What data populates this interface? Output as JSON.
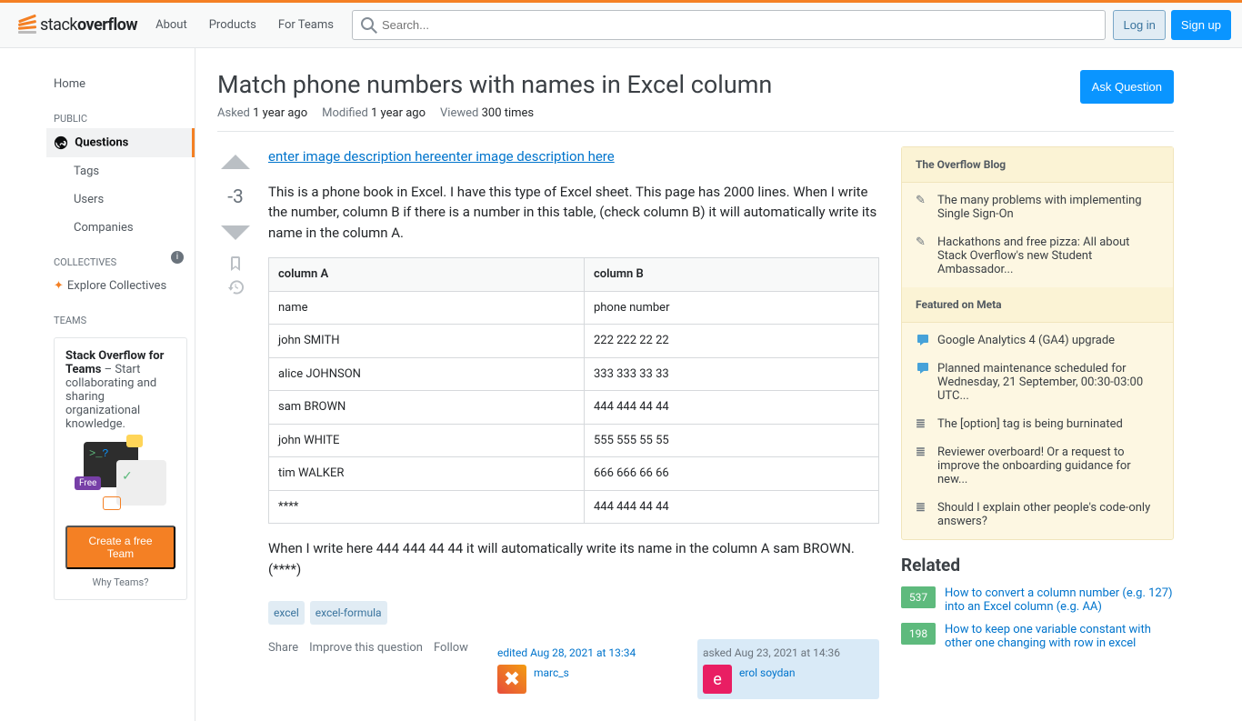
{
  "header": {
    "logo_text_1": "stack",
    "logo_text_2": "overflow",
    "nav": {
      "about": "About",
      "products": "Products",
      "for_teams": "For Teams"
    },
    "search_placeholder": "Search...",
    "login": "Log in",
    "signup": "Sign up"
  },
  "sidebar": {
    "home": "Home",
    "public_heading": "PUBLIC",
    "questions": "Questions",
    "tags": "Tags",
    "users": "Users",
    "companies": "Companies",
    "collectives_heading": "COLLECTIVES",
    "explore_collectives": "Explore Collectives",
    "teams_heading": "TEAMS",
    "teams_box_title": "Stack Overflow for Teams",
    "teams_box_text": " – Start collaborating and sharing organizational knowledge.",
    "teams_free_badge": "Free",
    "create_team": "Create a free Team",
    "why_teams": "Why Teams?"
  },
  "question": {
    "title": "Match phone numbers with names in Excel column",
    "ask_button": "Ask Question",
    "asked_label": "Asked",
    "asked_val": "1 year ago",
    "modified_label": "Modified",
    "modified_val": "1 year ago",
    "viewed_label": "Viewed",
    "viewed_val": "300 times",
    "vote_count": "-3",
    "body": {
      "link_text": "enter image description hereenter image description here",
      "para1": "This is a phone book in Excel. I have this type of Excel sheet. This page has 2000 lines. When I write the number, column B if there is a number in this table, (check column B) it will automatically write its name in the column A.",
      "table_headers": [
        "column A",
        "column B"
      ],
      "table_rows": [
        [
          "name",
          "phone number"
        ],
        [
          "john SMITH",
          "222 222 22 22"
        ],
        [
          "alice JOHNSON",
          "333 333 33 33"
        ],
        [
          "sam BROWN",
          "444 444 44 44"
        ],
        [
          "john WHITE",
          "555 555 55 55"
        ],
        [
          "tim WALKER",
          "666 666 66 66"
        ],
        [
          "****",
          "444 444 44 44"
        ]
      ],
      "para2": "When I write here 444 444 44 44 it will automatically write its name in the column A sam BROWN.(****)"
    },
    "tags": [
      "excel",
      "excel-formula"
    ],
    "actions": {
      "share": "Share",
      "improve": "Improve this question",
      "follow": "Follow"
    },
    "edited": {
      "action": "edited Aug 28, 2021 at 13:34",
      "user": "marc_s"
    },
    "asked": {
      "action": "asked Aug 23, 2021 at 14:36",
      "user": "erol soydan",
      "avatar_letter": "e"
    }
  },
  "right": {
    "blog_heading": "The Overflow Blog",
    "blog_items": [
      "The many problems with implementing Single Sign-On",
      "Hackathons and free pizza: All about Stack Overflow's new Student Ambassador..."
    ],
    "meta_heading": "Featured on Meta",
    "meta_items": [
      {
        "icon": "speech",
        "text": "Google Analytics 4 (GA4) upgrade"
      },
      {
        "icon": "speech",
        "text": "Planned maintenance scheduled for Wednesday, 21 September, 00:30-03:00 UTC..."
      },
      {
        "icon": "meta",
        "text": "The [option] tag is being burninated"
      },
      {
        "icon": "meta",
        "text": "Reviewer overboard! Or a request to improve the onboarding guidance for new..."
      },
      {
        "icon": "meta",
        "text": "Should I explain other people's code-only answers?"
      }
    ],
    "related_heading": "Related",
    "related_items": [
      {
        "score": "537",
        "text": "How to convert a column number (e.g. 127) into an Excel column (e.g. AA)"
      },
      {
        "score": "198",
        "text": "How to keep one variable constant with other one changing with row in excel"
      }
    ]
  }
}
